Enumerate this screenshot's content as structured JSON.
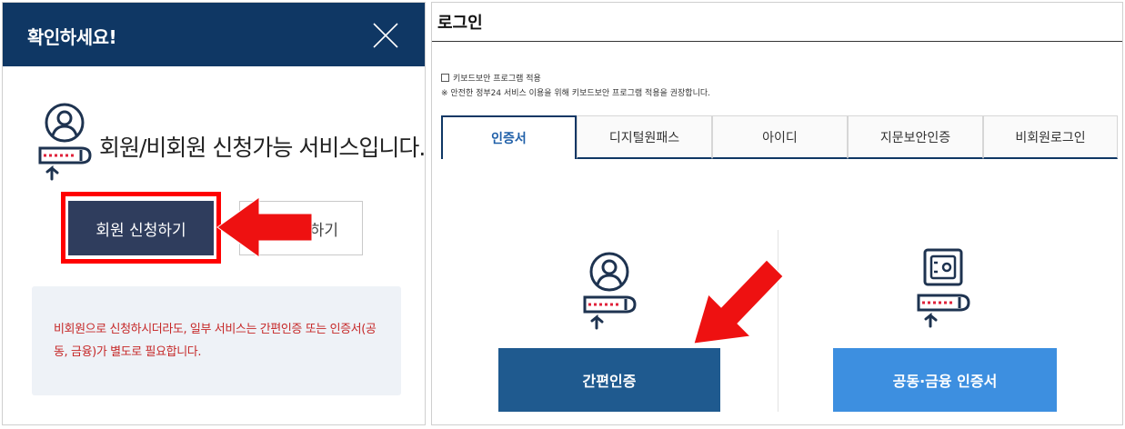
{
  "modal": {
    "title": "확인하세요!",
    "service_title": "회원/비회원 신청가능 서비스입니다.",
    "member_button": "회원 신청하기",
    "nonmember_button": "하기",
    "notice": "비회원으로 신청하시더라도, 일부 서비스는 간편인증 또는 인증서(공동, 금융)가 별도로 필요합니다."
  },
  "login": {
    "title": "로그인",
    "keyboard_security_label": "키보드보안 프로그램 적용",
    "keyboard_security_note": "※ 안전한 정부24 서비스 이용을 위해 키보드보안 프로그램 적용을 권장합니다.",
    "tabs": [
      {
        "label": "인증서",
        "active": true
      },
      {
        "label": "디지털원패스",
        "active": false
      },
      {
        "label": "아이디",
        "active": false
      },
      {
        "label": "지문보안인증",
        "active": false
      },
      {
        "label": "비회원로그인",
        "active": false
      }
    ],
    "simple_auth_button": "간편인증",
    "cert_button": "공동·금융 인증서"
  },
  "icons": {
    "close": "close-icon",
    "person_key": "person-key-icon",
    "safe_key": "safe-key-icon",
    "arrow": "red-arrow-icon"
  },
  "colors": {
    "header": "#0f3764",
    "member_button": "#2f3d5d",
    "highlight": "#ff0000",
    "notice_text": "#c62828",
    "simple_button": "#1f5a8f",
    "cert_button": "#3d8fe0"
  }
}
